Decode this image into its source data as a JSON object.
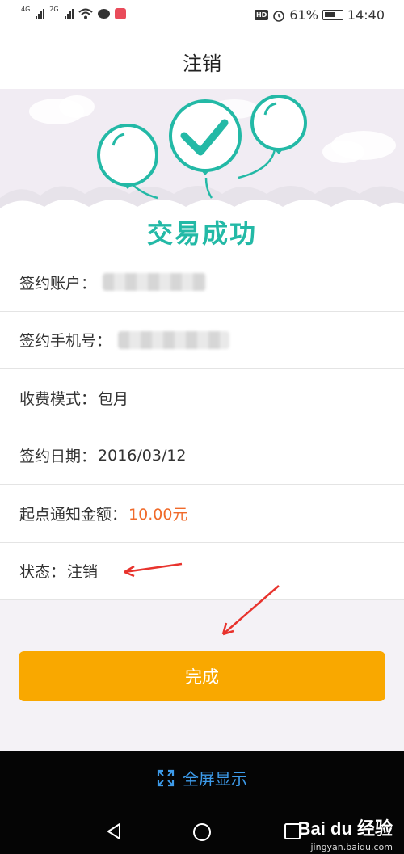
{
  "status_bar": {
    "signal_1": "4G",
    "signal_2": "2G",
    "hd": "HD",
    "battery": "61%",
    "time": "14:40"
  },
  "header": {
    "title": "注销"
  },
  "banner": {
    "success_text": "交易成功"
  },
  "info": {
    "account_label": "签约账户：",
    "phone_label": "签约手机号：",
    "fee_mode_label": "收费模式：",
    "fee_mode_value": "包月",
    "date_label": "签约日期：",
    "date_value": "2016/03/12",
    "threshold_label": "起点通知金额：",
    "threshold_value": "10.00元",
    "status_label": "状态：",
    "status_value": "注销"
  },
  "actions": {
    "done_label": "完成"
  },
  "bottom": {
    "fullscreen_label": "全屏显示"
  },
  "watermark": {
    "main": "Bai du 经验",
    "sub": "jingyan.baidu.com"
  },
  "colors": {
    "accent": "#f9a800",
    "teal": "#23b9a6",
    "amount": "#f06a2a",
    "link": "#3d9bea"
  }
}
